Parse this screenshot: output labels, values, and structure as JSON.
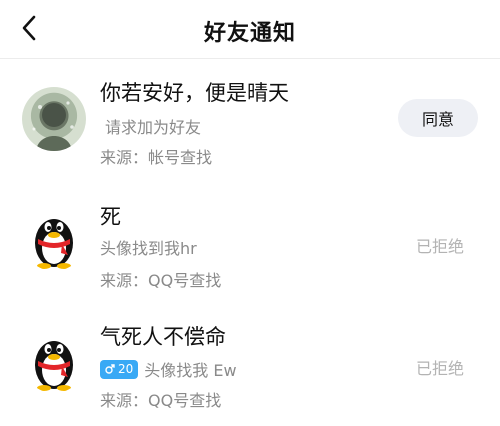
{
  "header": {
    "title": "好友通知"
  },
  "requests": [
    {
      "name": "你若安好，便是晴天",
      "message": "请求加为好友",
      "source": "来源：帐号查找",
      "action": "同意"
    },
    {
      "name": "死",
      "message": "头像找到我hr",
      "source": "来源：QQ号查找",
      "status": "已拒绝"
    },
    {
      "name": "气死人不偿命",
      "badge": {
        "icon": "male-symbol-icon",
        "age": "20",
        "color": "#39a9f5"
      },
      "message": "头像找我 Ew",
      "source": "来源：QQ号查找",
      "status": "已拒绝"
    }
  ]
}
